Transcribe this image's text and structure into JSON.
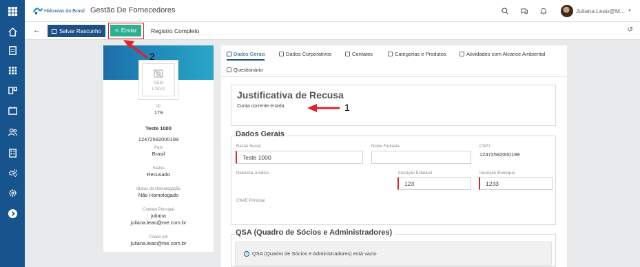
{
  "header": {
    "brand_text": "Hidrovias do Brasil",
    "app_title": "Gestão De Fornecedores",
    "user_name": "Juliana.Leao@M..."
  },
  "toolbar": {
    "save_label": "Salvar Rascunho",
    "send_label": "Enviar",
    "registro_label": "Registro Completo"
  },
  "profile": {
    "logo_text_1": "SEM",
    "logo_text_2": "LOGO",
    "id_label": "ID",
    "id_value": "179",
    "name": "Teste 1000",
    "cnpj": "12472592000199",
    "pais_label": "País",
    "pais_value": "Brasil",
    "status_label": "Status",
    "status_value": "Recusado",
    "homolog_label": "Status da Homologação",
    "homolog_value": "Não Homologado",
    "contato_label": "Contato Principal",
    "contato_name": "juliana",
    "contato_email": "juliana.leao@me.com.br",
    "criado_label": "Criado por",
    "criado_value": "juliana.leao@me.com.br"
  },
  "tabs": [
    {
      "label": "Dados Gerais"
    },
    {
      "label": "Dados Corporativos"
    },
    {
      "label": "Contatos"
    },
    {
      "label": "Categorias e Produtos"
    },
    {
      "label": "Atividades com Alcance Ambiental"
    },
    {
      "label": "Questionário"
    }
  ],
  "recusa": {
    "title": "Justificativa de Recusa",
    "text": "Conta corrente errada"
  },
  "dados_gerais": {
    "legend": "Dados Gerais",
    "razao_label": "Razão Social",
    "razao_value": "Teste 1000",
    "fantasia_label": "Nome Fantasia",
    "fantasia_value": "",
    "cnpj_label": "CNPJ",
    "cnpj_value": "12472592000199",
    "natureza_label": "Natureza Jurídica",
    "ie_label": "Inscrição Estadual",
    "ie_value": "123",
    "im_label": "Inscrição Municipal",
    "im_value": "1233",
    "cnae_label": "CNAE Principal"
  },
  "qsa": {
    "legend": "QSA (Quadro de Sócios e Administradores)",
    "empty_text": "QSA (Quadro de Sócios e Administradores) está vazio"
  },
  "annotations": {
    "label_1": "1",
    "label_2": "2"
  }
}
